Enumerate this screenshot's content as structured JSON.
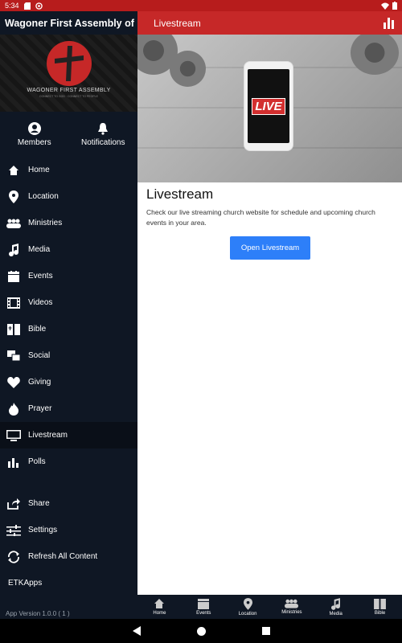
{
  "status_bar": {
    "time": "5:34"
  },
  "drawer": {
    "title": "Wagoner First Assembly of ...",
    "logo": {
      "name": "WAGONER FIRST ASSEMBLY",
      "tagline": "CONNECT TO GOD · CONNECT TO PEOPLE"
    },
    "top_actions": [
      {
        "label": "Members",
        "icon": "person-circle-icon"
      },
      {
        "label": "Notifications",
        "icon": "bell-icon"
      }
    ],
    "menu": [
      {
        "label": "Home",
        "icon": "home-icon"
      },
      {
        "label": "Location",
        "icon": "location-pin-icon"
      },
      {
        "label": "Ministries",
        "icon": "group-icon"
      },
      {
        "label": "Media",
        "icon": "music-note-icon"
      },
      {
        "label": "Events",
        "icon": "calendar-icon"
      },
      {
        "label": "Videos",
        "icon": "film-icon"
      },
      {
        "label": "Bible",
        "icon": "book-icon"
      },
      {
        "label": "Social",
        "icon": "chat-bubbles-icon"
      },
      {
        "label": "Giving",
        "icon": "heart-icon"
      },
      {
        "label": "Prayer",
        "icon": "flame-icon"
      },
      {
        "label": "Livestream",
        "icon": "monitor-icon",
        "active": true
      },
      {
        "label": "Polls",
        "icon": "bar-chart-icon"
      }
    ],
    "secondary": [
      {
        "label": "Share",
        "icon": "share-icon"
      },
      {
        "label": "Settings",
        "icon": "sliders-icon"
      },
      {
        "label": "Refresh All Content",
        "icon": "refresh-icon"
      },
      {
        "label": "ETKApps",
        "icon": ""
      }
    ],
    "version": "App Version 1.0.0 ( 1 )"
  },
  "appbar": {
    "title": "Livestream"
  },
  "main": {
    "hero_badge": "LIVE",
    "heading": "Livestream",
    "description": "Check our live streaming church website for schedule and upcoming church events in your area.",
    "button_label": "Open Livestream"
  },
  "tabs": [
    {
      "label": "Home",
      "icon": "home-icon"
    },
    {
      "label": "Events",
      "icon": "calendar-icon"
    },
    {
      "label": "Location",
      "icon": "location-pin-icon"
    },
    {
      "label": "Ministries",
      "icon": "group-icon"
    },
    {
      "label": "Media",
      "icon": "music-note-icon"
    },
    {
      "label": "Bible",
      "icon": "book-icon"
    }
  ],
  "colors": {
    "accent": "#c62828",
    "drawer": "#0f1724",
    "button": "#2d7ff9"
  }
}
